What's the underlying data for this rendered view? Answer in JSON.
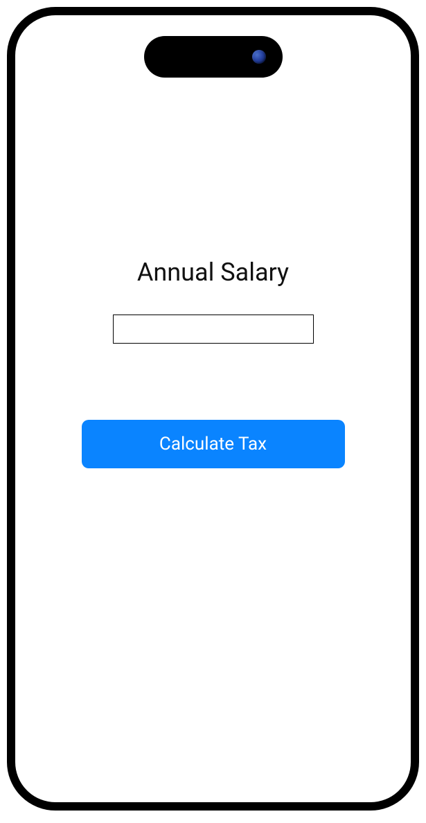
{
  "form": {
    "label": "Annual Salary",
    "input_value": "",
    "button_label": "Calculate Tax"
  },
  "colors": {
    "accent": "#0a84ff",
    "frame": "#000000",
    "text": "#111111"
  }
}
